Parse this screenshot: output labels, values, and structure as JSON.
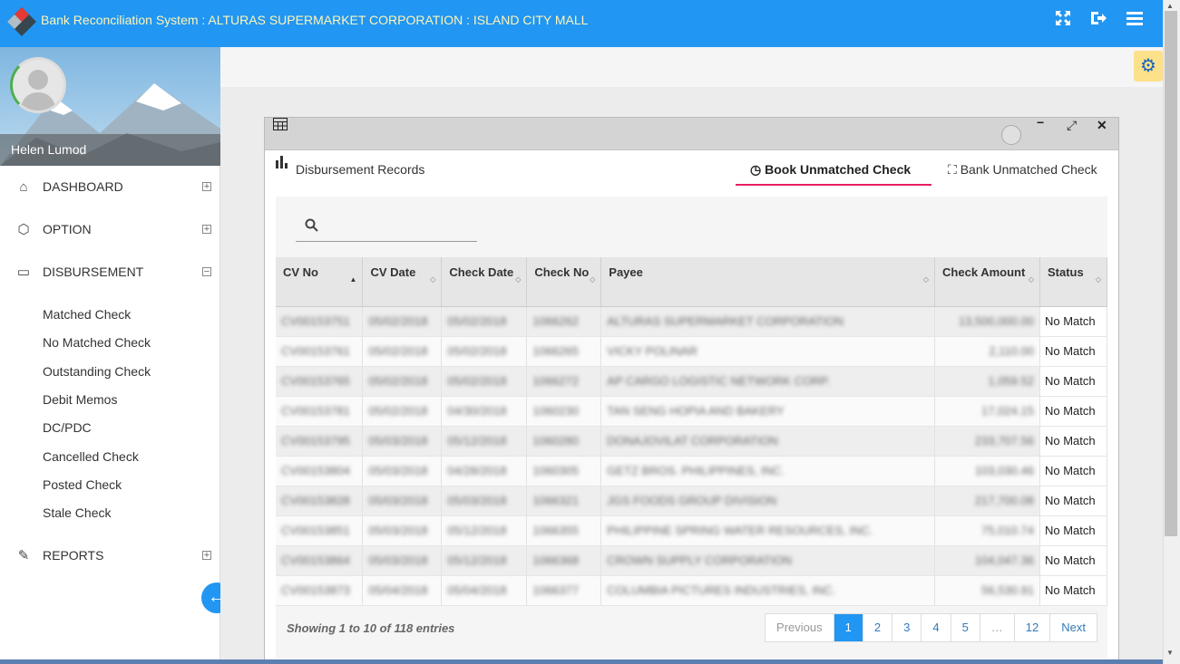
{
  "app": {
    "title": "Bank Reconciliation System : ALTURAS SUPERMARKET CORPORATION : ISLAND CITY MALL"
  },
  "top_icons": [
    "fullscreen-icon",
    "logout-icon",
    "menu-icon"
  ],
  "user": {
    "name": "Helen Lumod"
  },
  "nav": {
    "dashboard": "DASHBOARD",
    "option": "OPTION",
    "disbursement": "DISBURSEMENT",
    "reports": "REPORTS",
    "disbursement_items": [
      "Matched Check",
      "No Matched Check",
      "Outstanding Check",
      "Debit Memos",
      "DC/PDC",
      "Cancelled Check",
      "Posted Check",
      "Stale Check"
    ]
  },
  "panel": {
    "section_title": "Disbursement Records",
    "tabs": {
      "book": "Book Unmatched Check",
      "bank": "Bank Unmatched Check"
    }
  },
  "search": {
    "placeholder": ""
  },
  "table": {
    "headers": {
      "cv_no": "CV No",
      "cv_date": "CV Date",
      "check_date": "Check Date",
      "check_no": "Check No",
      "payee": "Payee",
      "check_amount": "Check Amount",
      "status": "Status"
    },
    "rows": [
      {
        "cv_no": "CV00153751",
        "cv_date": "05/02/2018",
        "check_date": "05/02/2018",
        "check_no": "1066262",
        "payee": "ALTURAS SUPERMARKET CORPORATION",
        "amount": "13,500,000.00",
        "status": "No Match"
      },
      {
        "cv_no": "CV00153761",
        "cv_date": "05/02/2018",
        "check_date": "05/02/2018",
        "check_no": "1066265",
        "payee": "VICKY POLINAR",
        "amount": "2,110.00",
        "status": "No Match"
      },
      {
        "cv_no": "CV00153765",
        "cv_date": "05/02/2018",
        "check_date": "05/02/2018",
        "check_no": "1066272",
        "payee": "AP CARGO LOGISTIC NETWORK CORP.",
        "amount": "1,059.52",
        "status": "No Match"
      },
      {
        "cv_no": "CV00153781",
        "cv_date": "05/02/2018",
        "check_date": "04/30/2018",
        "check_no": "1060230",
        "payee": "TAN SENG HOPIA AND BAKERY",
        "amount": "17,024.15",
        "status": "No Match"
      },
      {
        "cv_no": "CV00153795",
        "cv_date": "05/03/2018",
        "check_date": "05/12/2018",
        "check_no": "1060280",
        "payee": "DONAJOVILAT CORPORATION",
        "amount": "233,707.56",
        "status": "No Match"
      },
      {
        "cv_no": "CV00153804",
        "cv_date": "05/03/2018",
        "check_date": "04/28/2018",
        "check_no": "1060305",
        "payee": "GETZ BROS. PHILIPPINES, INC.",
        "amount": "103,030.46",
        "status": "No Match"
      },
      {
        "cv_no": "CV00153828",
        "cv_date": "05/03/2018",
        "check_date": "05/03/2018",
        "check_no": "1066321",
        "payee": "JGS FOODS GROUP DIVISION",
        "amount": "217,700.08",
        "status": "No Match"
      },
      {
        "cv_no": "CV00153851",
        "cv_date": "05/03/2018",
        "check_date": "05/12/2018",
        "check_no": "1066355",
        "payee": "PHILIPPINE SPRING WATER RESOURCES, INC.",
        "amount": "75,010.74",
        "status": "No Match"
      },
      {
        "cv_no": "CV00153864",
        "cv_date": "05/03/2018",
        "check_date": "05/12/2018",
        "check_no": "1066368",
        "payee": "CROWN SUPPLY CORPORATION",
        "amount": "104,047.36",
        "status": "No Match"
      },
      {
        "cv_no": "CV00153873",
        "cv_date": "05/04/2018",
        "check_date": "05/04/2018",
        "check_no": "1066377",
        "payee": "COLUMBIA PICTURES INDUSTRIES, INC.",
        "amount": "56,530.91",
        "status": "No Match"
      }
    ]
  },
  "footer": {
    "info": "Showing 1 to 10 of 118 entries",
    "pagination": {
      "previous": "Previous",
      "pages": [
        "1",
        "2",
        "3",
        "4",
        "5",
        "…",
        "12"
      ],
      "next": "Next"
    }
  },
  "colors": {
    "topbar": "#2196f3",
    "title_text": "#fff5b8",
    "active_tab_underline": "#e91e63",
    "page_active": "#2196f3"
  }
}
